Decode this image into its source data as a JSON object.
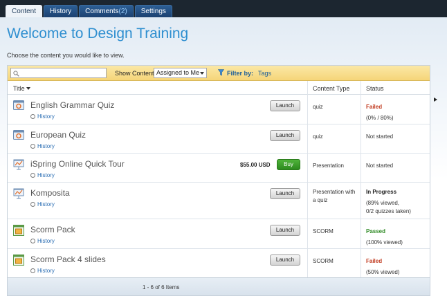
{
  "tabs": [
    {
      "label": "Content",
      "active": true
    },
    {
      "label": "History"
    },
    {
      "label": "Comments",
      "count": "(2)"
    },
    {
      "label": "Settings"
    }
  ],
  "page": {
    "title": "Welcome to Design Training",
    "intro": "Choose the content you would like to view."
  },
  "filter": {
    "search_value": "",
    "show_content_label": "Show Content:",
    "show_content_value": "Assigned to Me",
    "filter_by_label": "Filter by:",
    "tags_label": "Tags"
  },
  "table": {
    "headers": {
      "title": "Title",
      "content_type": "Content Type",
      "status": "Status"
    },
    "history_label": "History",
    "rows": [
      {
        "title": "English Grammar Quiz",
        "icon": "quiz-icon",
        "action": "Launch",
        "content_type": "quiz",
        "status": "Failed",
        "status_detail": "(0% / 80%)"
      },
      {
        "title": "European Quiz",
        "icon": "quiz-icon",
        "action": "Launch",
        "content_type": "quiz",
        "status": "Not started"
      },
      {
        "title": "iSpring Online Quick Tour",
        "icon": "presentation-icon",
        "price": "$55.00 USD",
        "action": "Buy",
        "content_type": "Presentation",
        "status": "Not started"
      },
      {
        "title": "Komposita",
        "icon": "presentation-icon",
        "action": "Launch",
        "content_type_line1": "Presentation with",
        "content_type_line2": "a quiz",
        "status": "In Progress",
        "status_detail": "(89% viewed,",
        "status_detail2": "0/2 quizzes taken)"
      },
      {
        "title": "Scorm Pack",
        "icon": "scorm-icon",
        "action": "Launch",
        "content_type": "SCORM",
        "status": "Passed",
        "status_detail": "(100% viewed)"
      },
      {
        "title": "Scorm Pack 4 slides",
        "icon": "scorm-icon",
        "action": "Launch",
        "content_type": "SCORM",
        "status": "Failed",
        "status_detail": "(50% viewed)"
      }
    ]
  },
  "footer": {
    "pagination": "1 - 6 of 6 Items"
  },
  "colors": {
    "accent": "#2f8fd0",
    "failed": "#c0391e",
    "passed": "#2e8a24",
    "buy": "#3a9e2b"
  }
}
